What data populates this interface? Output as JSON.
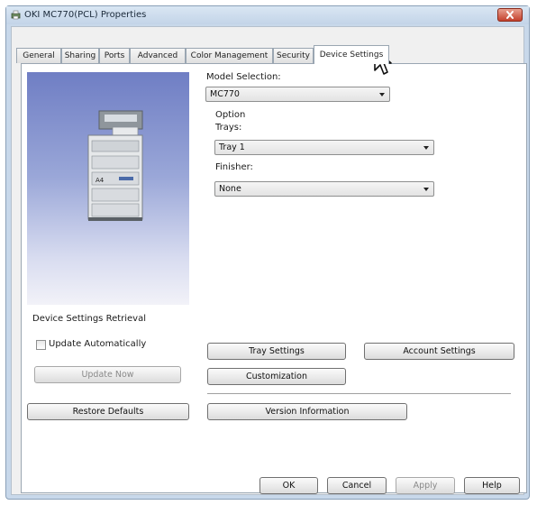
{
  "window": {
    "title": "OKI MC770(PCL) Properties"
  },
  "tabs": [
    {
      "label": "General"
    },
    {
      "label": "Sharing"
    },
    {
      "label": "Ports"
    },
    {
      "label": "Advanced"
    },
    {
      "label": "Color Management"
    },
    {
      "label": "Security"
    },
    {
      "label": "Device Settings"
    }
  ],
  "device": {
    "model_label": "Model Selection:",
    "model_value": "MC770",
    "option_label": "Option",
    "trays_label": "Trays:",
    "trays_value": "Tray 1",
    "finisher_label": "Finisher:",
    "finisher_value": "None",
    "printer_tray_text": "A4"
  },
  "retrieval": {
    "heading": "Device Settings Retrieval",
    "update_auto_label": "Update Automatically",
    "update_auto_checked": false,
    "update_now_label": "Update Now"
  },
  "buttons": {
    "tray_settings": "Tray Settings",
    "account_settings": "Account Settings",
    "customization": "Customization",
    "restore_defaults": "Restore Defaults",
    "version_information": "Version Information"
  },
  "dialog": {
    "ok": "OK",
    "cancel": "Cancel",
    "apply": "Apply",
    "help": "Help"
  },
  "colors": {
    "title_bar": "#c3d4e8",
    "close_button": "#c4402c",
    "preview_gradient_top": "#6f7ec4"
  }
}
